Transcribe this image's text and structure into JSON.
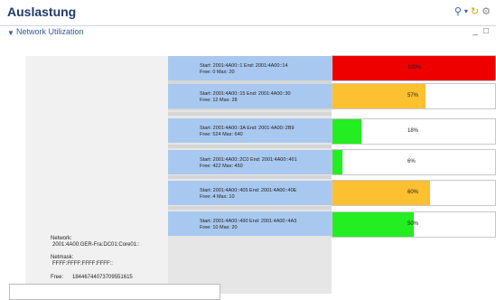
{
  "header": {
    "title": "Auslastung"
  },
  "section": {
    "label": "Network Utilization"
  },
  "info": {
    "network_label": "Network:",
    "network_value": "2001:4A00:GER-Fra:DC01:Core01::",
    "netmask_label": "Netmask:",
    "netmask_value": "FFFF:FFFF:FFFF:FFFF::",
    "free_label": "Free:",
    "free_value": "18446744073709551615"
  },
  "blocks": [
    {
      "line1": "Start: 2001:4A00::1   End: 2001:4A00::14",
      "line2": "Free: 0   Max: 20",
      "percent": 100,
      "percent_label": "100%",
      "color": "#ee0000"
    },
    {
      "line1": "Start: 2001:4A00::15   End: 2001:4A00::30",
      "line2": "Free: 12   Max: 28",
      "percent": 57,
      "percent_label": "57%",
      "color": "#fcc030"
    },
    {
      "line1": "Start: 2001:4A00::3A   End: 2001:4A00::2B9",
      "line2": "Free: 524   Max: 640",
      "percent": 18,
      "percent_label": "18%",
      "color": "#22ee22"
    },
    {
      "line1": "Start: 2001:4A00::2C0   End: 2001:4A00::401",
      "line2": "Free: 422   Max: 450",
      "percent": 6,
      "percent_label": "6%",
      "color": "#22ee22"
    },
    {
      "line1": "Start: 2001:4A00::405   End: 2001:4A00::40E",
      "line2": "Free: 4   Max: 10",
      "percent": 60,
      "percent_label": "60%",
      "color": "#fcc030"
    },
    {
      "line1": "Start: 2001:4A00::490   End: 2001:4A00::4A3",
      "line2": "Free: 10   Max: 20",
      "percent": 50,
      "percent_label": "50%",
      "color": "#22ee22"
    }
  ]
}
